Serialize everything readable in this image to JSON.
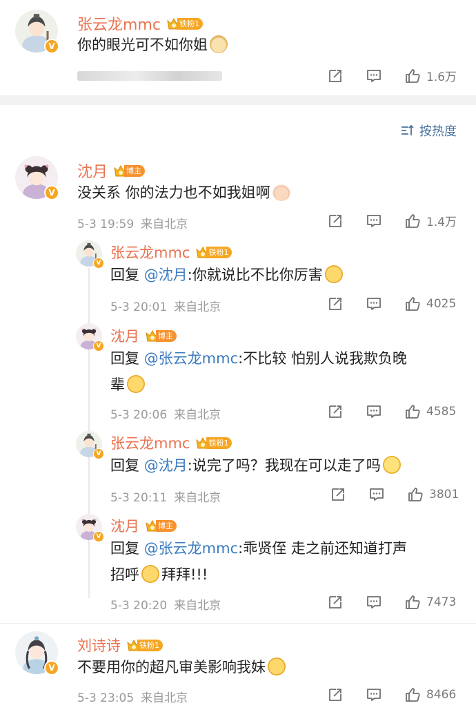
{
  "colors": {
    "username": "#eb7350",
    "mention": "#3b7bbf",
    "meta": "#9a9a9a",
    "divider": "#f2f2f2",
    "sort": "#4a72a0"
  },
  "top_comment": {
    "username": "张云龙mmc",
    "badge": "铁粉1",
    "text": "你的眼光可不如你姐",
    "like_count": "1.6万"
  },
  "sort_label": "按热度",
  "comments": [
    {
      "username": "沈月",
      "badge": "博主",
      "text": "没关系 你的法力也不如我姐啊",
      "date": "5-3 19:59",
      "location": "来自北京",
      "like_count": "1.4万",
      "replies": [
        {
          "username": "张云龙mmc",
          "badge": "铁粉1",
          "reply_prefix": "回复",
          "mention": "@沈月",
          "text": ":你就说比不比你厉害",
          "date": "5-3 20:01",
          "location": "来自北京",
          "like_count": "4025"
        },
        {
          "username": "沈月",
          "badge": "博主",
          "reply_prefix": "回复",
          "mention": "@张云龙mmc",
          "text": ":不比较 怕别人说我欺负晚",
          "text2": "辈",
          "date": "5-3 20:06",
          "location": "来自北京",
          "like_count": "4585"
        },
        {
          "username": "张云龙mmc",
          "badge": "铁粉1",
          "reply_prefix": "回复",
          "mention": "@沈月",
          "text": ":说完了吗？我现在可以走了吗",
          "date": "5-3 20:11",
          "location": "来自北京",
          "like_count": "3801"
        },
        {
          "username": "沈月",
          "badge": "博主",
          "reply_prefix": "回复",
          "mention": "@张云龙mmc",
          "text": ":乖贤侄 走之前还知道打声",
          "text2a": "招呼",
          "text2b": "拜拜!!!",
          "date": "5-3 20:20",
          "location": "来自北京",
          "like_count": "7473"
        }
      ]
    },
    {
      "username": "刘诗诗",
      "badge": "铁粉1",
      "text": "不要用你的超凡审美影响我妹",
      "date": "5-3 23:05",
      "location": "来自北京",
      "like_count": "8466"
    }
  ],
  "icons": {
    "verified": "V",
    "share": "share-icon",
    "comment": "comment-icon",
    "like": "thumb-up-icon",
    "sort": "sort-icon"
  }
}
